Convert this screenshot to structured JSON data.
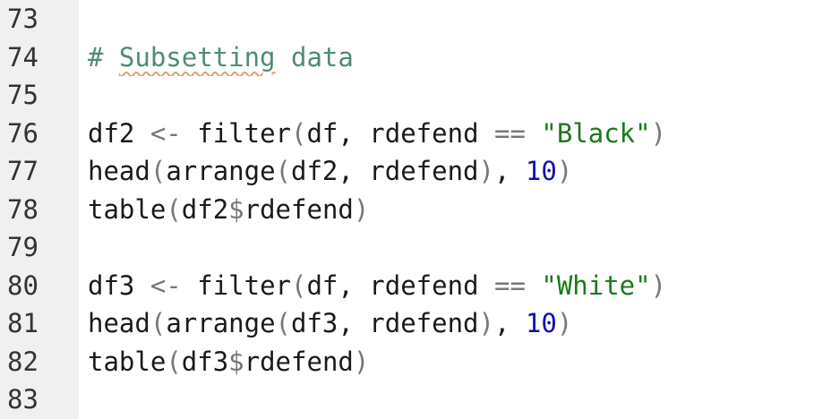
{
  "editor": {
    "line_numbers": [
      "73",
      "74",
      "75",
      "76",
      "77",
      "78",
      "79",
      "80",
      "81",
      "82",
      "83"
    ],
    "lines": [
      [],
      [
        {
          "t": "# ",
          "c": "comment"
        },
        {
          "t": "Subsetting",
          "c": "comment squiggle"
        },
        {
          "t": " data",
          "c": "comment"
        }
      ],
      [],
      [
        {
          "t": "df2",
          "c": "ident"
        },
        {
          "t": " <- ",
          "c": "op"
        },
        {
          "t": "filter",
          "c": "ident"
        },
        {
          "t": "(",
          "c": "paren"
        },
        {
          "t": "df, rdefend ",
          "c": "ident"
        },
        {
          "t": "==",
          "c": "op"
        },
        {
          "t": " ",
          "c": "ident"
        },
        {
          "t": "\"Black\"",
          "c": "string"
        },
        {
          "t": ")",
          "c": "paren"
        }
      ],
      [
        {
          "t": "head",
          "c": "ident"
        },
        {
          "t": "(",
          "c": "paren"
        },
        {
          "t": "arrange",
          "c": "ident"
        },
        {
          "t": "(",
          "c": "paren"
        },
        {
          "t": "df2, rdefend",
          "c": "ident"
        },
        {
          "t": ")",
          "c": "paren"
        },
        {
          "t": ", ",
          "c": "punct"
        },
        {
          "t": "10",
          "c": "number"
        },
        {
          "t": ")",
          "c": "paren"
        }
      ],
      [
        {
          "t": "table",
          "c": "ident"
        },
        {
          "t": "(",
          "c": "paren"
        },
        {
          "t": "df2",
          "c": "ident"
        },
        {
          "t": "$",
          "c": "dollar"
        },
        {
          "t": "rdefend",
          "c": "ident"
        },
        {
          "t": ")",
          "c": "paren"
        }
      ],
      [],
      [
        {
          "t": "df3",
          "c": "ident"
        },
        {
          "t": " <- ",
          "c": "op"
        },
        {
          "t": "filter",
          "c": "ident"
        },
        {
          "t": "(",
          "c": "paren"
        },
        {
          "t": "df, rdefend ",
          "c": "ident"
        },
        {
          "t": "==",
          "c": "op"
        },
        {
          "t": " ",
          "c": "ident"
        },
        {
          "t": "\"White\"",
          "c": "string"
        },
        {
          "t": ")",
          "c": "paren"
        }
      ],
      [
        {
          "t": "head",
          "c": "ident"
        },
        {
          "t": "(",
          "c": "paren"
        },
        {
          "t": "arrange",
          "c": "ident"
        },
        {
          "t": "(",
          "c": "paren"
        },
        {
          "t": "df3, rdefend",
          "c": "ident"
        },
        {
          "t": ")",
          "c": "paren"
        },
        {
          "t": ", ",
          "c": "punct"
        },
        {
          "t": "10",
          "c": "number"
        },
        {
          "t": ")",
          "c": "paren"
        }
      ],
      [
        {
          "t": "table",
          "c": "ident"
        },
        {
          "t": "(",
          "c": "paren"
        },
        {
          "t": "df3",
          "c": "ident"
        },
        {
          "t": "$",
          "c": "dollar"
        },
        {
          "t": "rdefend",
          "c": "ident"
        },
        {
          "t": ")",
          "c": "paren"
        }
      ],
      []
    ]
  },
  "colors": {
    "gutter_background": "#f0f0f0",
    "comment": "#4f8b74",
    "string": "#1a7a1a",
    "number": "#1010b0",
    "operator": "#777777"
  }
}
